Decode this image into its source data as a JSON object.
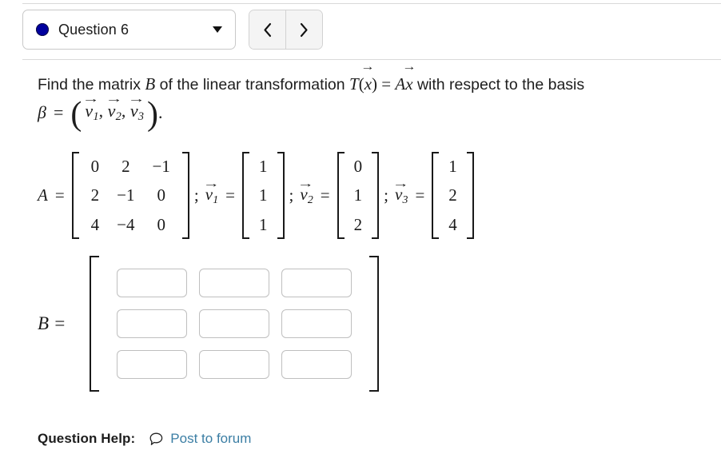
{
  "nav": {
    "question_label": "Question 6",
    "status_dot_color": "#00009e",
    "caret_icon": "chevron-down-icon",
    "prev_label": "‹",
    "next_label": "›"
  },
  "prompt": {
    "text_before": "Find the matrix ",
    "matrix_symbol": "B",
    "text_mid": " of the linear transformation ",
    "transform": "T(x⃗) = Ax⃗",
    "text_after": " with respect to the basis",
    "basis_symbol": "β",
    "basis_equals": "=",
    "basis_vectors": [
      "v1",
      "v2",
      "v3"
    ],
    "basis_period": "."
  },
  "given": {
    "A_label": "A",
    "A_equals": "=",
    "A_matrix": [
      [
        "0",
        "2",
        "−1"
      ],
      [
        "2",
        "−1",
        "0"
      ],
      [
        "4",
        "−4",
        "0"
      ]
    ],
    "separator": ";",
    "vectors": [
      {
        "name": "v",
        "sub": "1",
        "equals": "=",
        "values": [
          "1",
          "1",
          "1"
        ]
      },
      {
        "name": "v",
        "sub": "2",
        "equals": "=",
        "values": [
          "0",
          "1",
          "2"
        ]
      },
      {
        "name": "v",
        "sub": "3",
        "equals": "=",
        "values": [
          "1",
          "2",
          "4"
        ]
      }
    ]
  },
  "answer": {
    "label": "B",
    "equals": "=",
    "rows": 3,
    "cols": 3,
    "cells": [
      {
        "value": "",
        "placeholder": ""
      },
      {
        "value": "",
        "placeholder": ""
      },
      {
        "value": "",
        "placeholder": ""
      },
      {
        "value": "",
        "placeholder": ""
      },
      {
        "value": "",
        "placeholder": ""
      },
      {
        "value": "",
        "placeholder": ""
      },
      {
        "value": "",
        "placeholder": ""
      },
      {
        "value": "",
        "placeholder": ""
      },
      {
        "value": "",
        "placeholder": ""
      }
    ]
  },
  "footer": {
    "help_label": "Question Help:",
    "forum_icon": "speech-bubble-icon",
    "forum_link_text": "Post to forum",
    "link_color": "#3b7ea4"
  }
}
